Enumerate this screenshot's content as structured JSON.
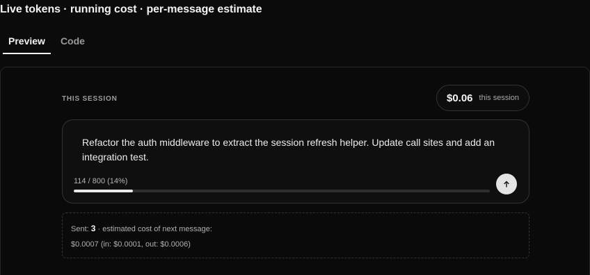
{
  "page": {
    "title": "Live tokens · running cost · per-message estimate"
  },
  "tabs": [
    {
      "label": "Preview",
      "active": true
    },
    {
      "label": "Code",
      "active": false
    }
  ],
  "session": {
    "label": "THIS SESSION",
    "cost_amount": "$0.06",
    "cost_suffix": "this session"
  },
  "composer": {
    "message": "Refactor the auth middleware to extract the session refresh helper. Update call sites and add an integration test.",
    "token_count": "114 / 800 (14%)",
    "progress_fraction": 0.1425,
    "send_icon": "arrow-up-icon"
  },
  "estimate": {
    "sent_label": "Sent:",
    "sent_count": "3",
    "sent_suffix": "· estimated cost of next message:",
    "cost_line": "$0.0007 (in: $0.0001, out: $0.0006)"
  },
  "colors": {
    "background": "#0b0b0b",
    "panel": "#0a0a0a",
    "border": "#333333",
    "progress_fill": "#e8e8e8",
    "progress_track": "#2e2e2e",
    "send_button": "#e4e4e4"
  }
}
